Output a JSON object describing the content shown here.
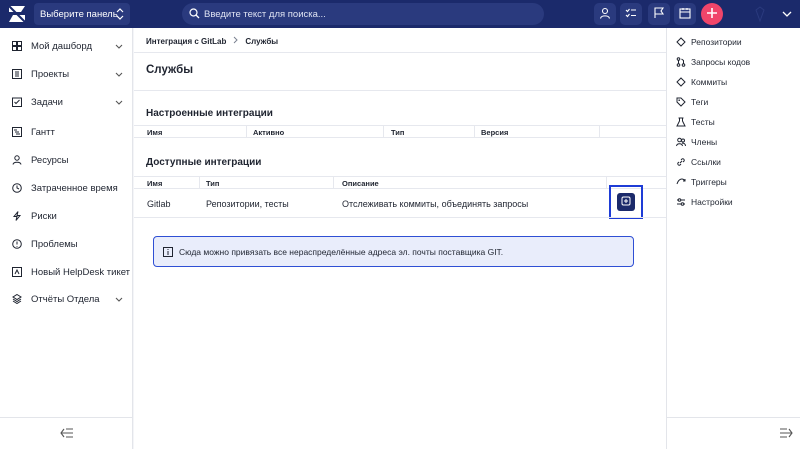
{
  "colors": {
    "topbar": "#1b2a6b",
    "accent": "#1e3cd6",
    "plus_button": "#f0456a",
    "info_bg": "#e9edfb"
  },
  "topbar": {
    "panel_select": "Выберите панель",
    "search_placeholder": "Введите текст для поиска...",
    "icons": [
      "user-icon",
      "checklist-icon",
      "flag-icon",
      "calendar-icon",
      "plus-icon",
      "avatar-icon",
      "menu-chevron-icon"
    ]
  },
  "sidebar": {
    "items": [
      {
        "label": "Мой дашборд",
        "icon": "dashboard-icon",
        "expandable": true
      },
      {
        "label": "Проекты",
        "icon": "projects-icon",
        "expandable": true
      },
      {
        "label": "Задачи",
        "icon": "tasks-icon",
        "expandable": true
      },
      {
        "label": "Гантт",
        "icon": "gantt-icon",
        "expandable": false
      },
      {
        "label": "Ресурсы",
        "icon": "resources-icon",
        "expandable": false
      },
      {
        "label": "Затраченное время",
        "icon": "clock-icon",
        "expandable": false
      },
      {
        "label": "Риски",
        "icon": "risk-icon",
        "expandable": false
      },
      {
        "label": "Проблемы",
        "icon": "problem-icon",
        "expandable": false
      },
      {
        "label": "Новый HelpDesk тикет",
        "icon": "helpdesk-icon",
        "expandable": false
      },
      {
        "label": "Отчёты Отдела",
        "icon": "reports-icon",
        "expandable": true
      }
    ]
  },
  "breadcrumb": {
    "parent": "Интеграция с GitLab",
    "current": "Службы"
  },
  "page": {
    "title": "Службы"
  },
  "configured": {
    "title": "Настроенные интеграции",
    "columns": [
      "Имя",
      "Активно",
      "Тип",
      "Версия"
    ]
  },
  "available": {
    "title": "Доступные интеграции",
    "columns": [
      "Имя",
      "Тип",
      "Описание"
    ],
    "rows": [
      {
        "name": "Gitlab",
        "type": "Репозитории, тесты",
        "description": "Отслеживать коммиты, объединять запросы"
      }
    ]
  },
  "info_message": "Сюда можно привязать все нераспределённые адреса эл. почты поставщика GIT.",
  "right_sidebar": {
    "items": [
      {
        "label": "Репозитории",
        "icon": "repository-icon"
      },
      {
        "label": "Запросы кодов",
        "icon": "merge-request-icon"
      },
      {
        "label": "Коммиты",
        "icon": "commit-icon"
      },
      {
        "label": "Теги",
        "icon": "tag-icon"
      },
      {
        "label": "Тесты",
        "icon": "tests-icon"
      },
      {
        "label": "Члены",
        "icon": "members-icon"
      },
      {
        "label": "Ссылки",
        "icon": "link-icon"
      },
      {
        "label": "Триггеры",
        "icon": "trigger-icon"
      },
      {
        "label": "Настройки",
        "icon": "settings-icon"
      }
    ]
  }
}
